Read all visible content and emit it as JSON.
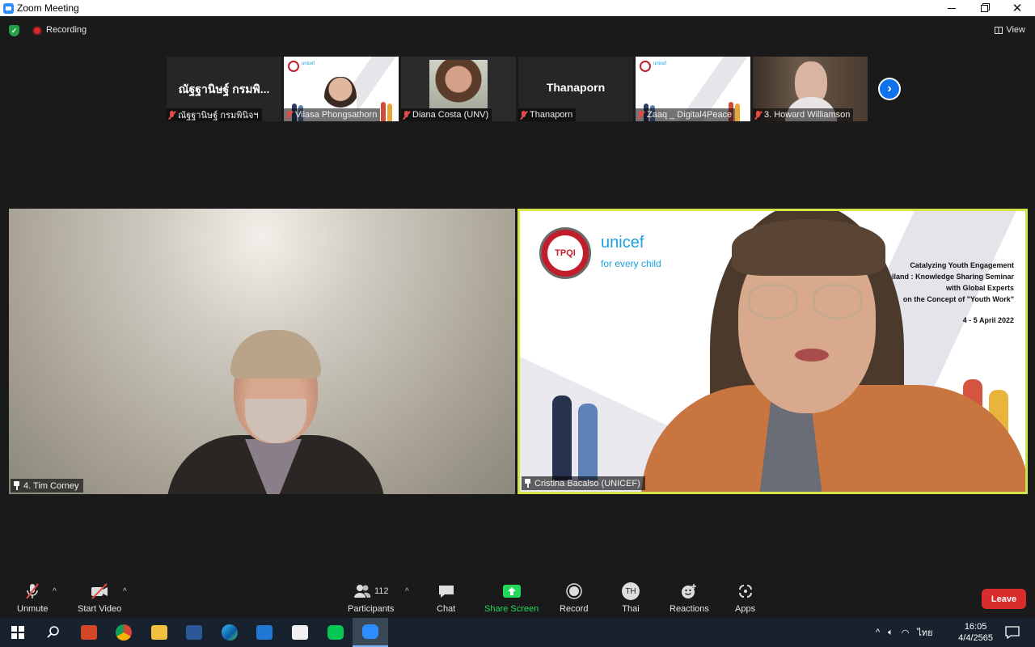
{
  "window": {
    "title": "Zoom Meeting"
  },
  "topbar": {
    "recording_label": "Recording",
    "view_label": "View"
  },
  "strip": {
    "participants": [
      {
        "display_name": "ณัฐฐานิษฐ์ กรมพิ...",
        "label": "ณัฐฐานิษฐ์ กรมพินิจฯ",
        "kind": "name"
      },
      {
        "display_name": "",
        "label": "Vilasa Phongsathorn",
        "kind": "video-slide"
      },
      {
        "display_name": "",
        "label": "Diana Costa (UNV)",
        "kind": "video"
      },
      {
        "display_name": "Thanaporn",
        "label": "Thanaporn",
        "kind": "name"
      },
      {
        "display_name": "",
        "label": "Zaaq _ Digital4Peace",
        "kind": "slide"
      },
      {
        "display_name": "",
        "label": "3. Howard Williamson",
        "kind": "video"
      }
    ],
    "next_icon": "chevron-right-icon"
  },
  "main": {
    "left": {
      "label": "4. Tim Corney"
    },
    "right": {
      "label": "Cristina Bacalso (UNICEF)",
      "slide": {
        "badge": "TPQI",
        "brand": "unicef",
        "tagline": "for every child",
        "heading_lines": [
          "Catalyzing Youth Engagement",
          "Thailand : Knowledge Sharing Seminar",
          "with Global Experts",
          "on the Concept of \"Youth Work\""
        ],
        "date": "4 - 5 April 2022"
      }
    }
  },
  "toolbar": {
    "unmute": "Unmute",
    "start_video": "Start Video",
    "participants": "Participants",
    "participants_count": "112",
    "chat": "Chat",
    "share_screen": "Share Screen",
    "record": "Record",
    "thai": "Thai",
    "thai_initials": "TH",
    "reactions": "Reactions",
    "apps": "Apps",
    "leave": "Leave"
  },
  "taskbar": {
    "lang": "ไทย",
    "time": "16:05",
    "date": "4/4/2565"
  },
  "colors": {
    "accent": "#2d8cff",
    "share_green": "#23d959",
    "leave_red": "#d92c2c",
    "active_border": "#d3e34a"
  }
}
